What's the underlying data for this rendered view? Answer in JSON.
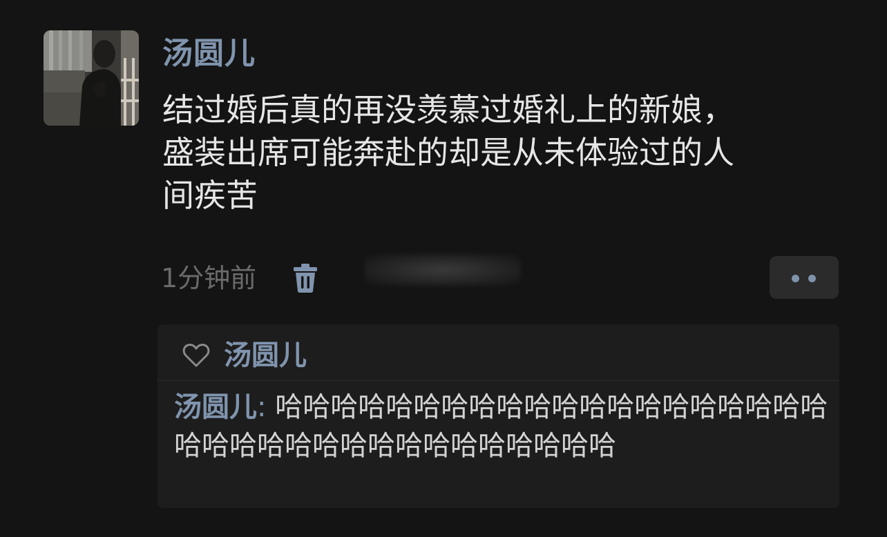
{
  "post": {
    "username": "汤圆儿",
    "text": "结过婚后真的再没羡慕过婚礼上的新娘，\n盛装出席可能奔赴的却是从未体验过的人\n间疾苦",
    "time": "1分钟前"
  },
  "icons": {
    "delete": "trash-icon",
    "more": "more-dots-icon",
    "like": "heart-outline-icon"
  },
  "likes": {
    "names": "汤圆儿"
  },
  "comment": {
    "author": "汤圆儿",
    "separator": ":",
    "text": " 哈哈哈哈哈哈哈哈哈哈哈哈哈哈哈哈哈哈哈哈哈哈哈哈哈哈哈哈哈哈哈哈哈哈哈哈"
  },
  "colors": {
    "background": "#141414",
    "name_accent": "#8094ae",
    "text": "#e6e6e6",
    "muted": "#6b6b6b",
    "panel": "#1d1d1d"
  }
}
